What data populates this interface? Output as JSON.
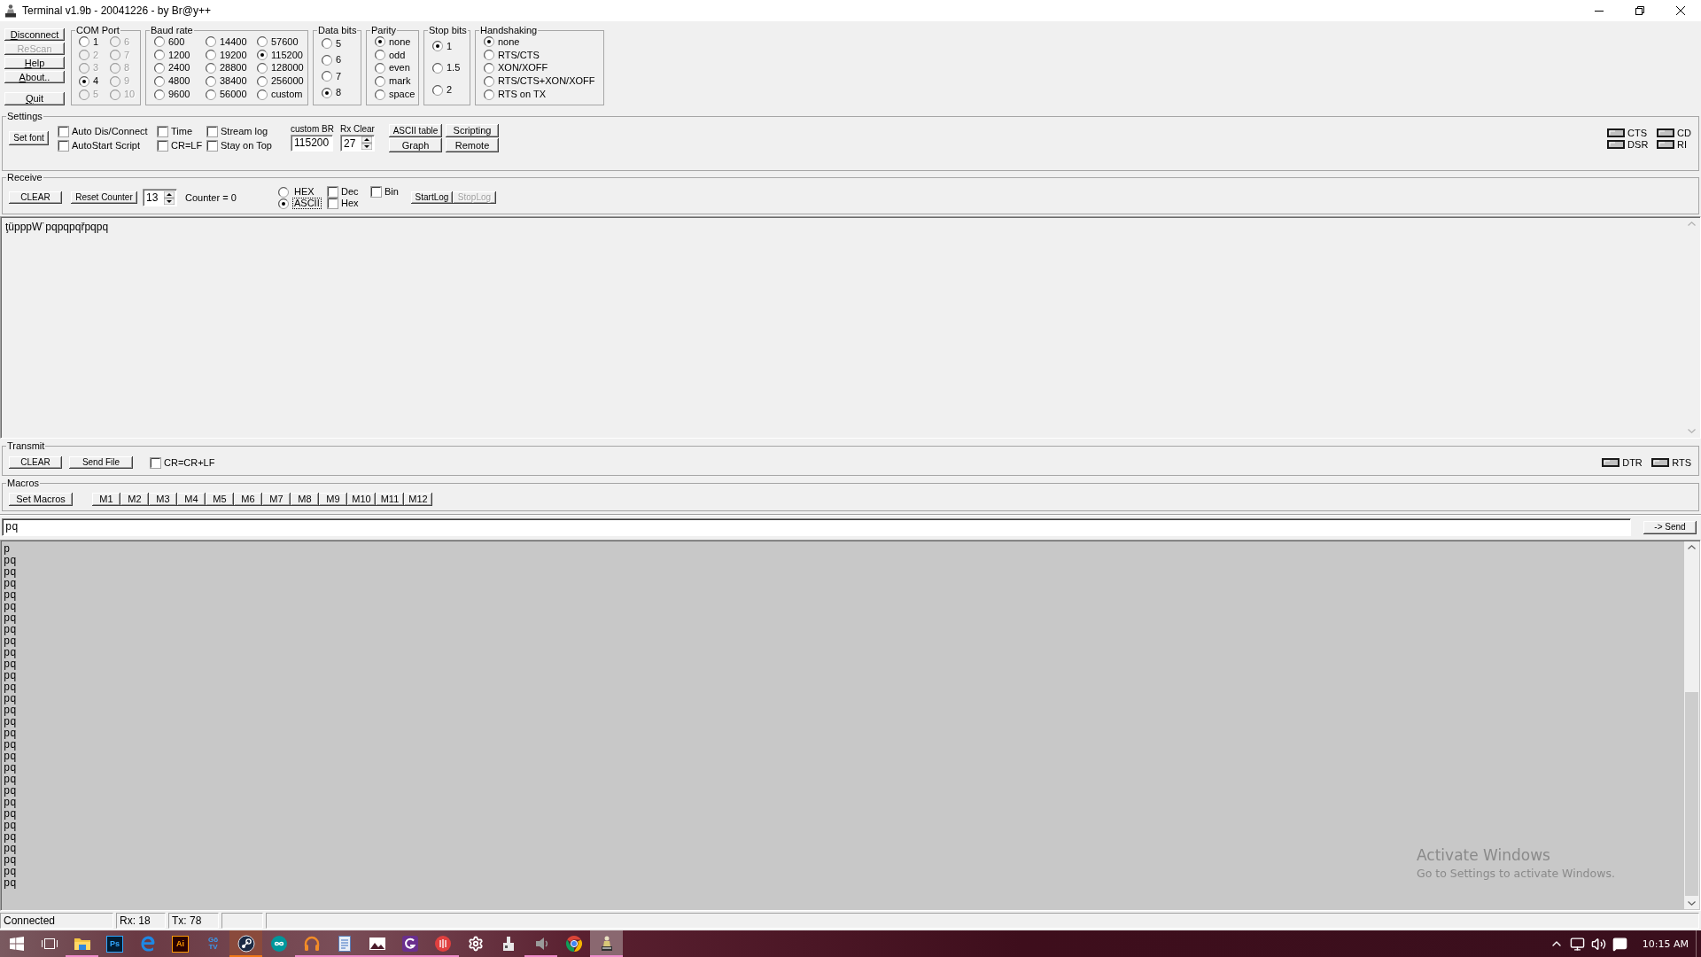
{
  "window": {
    "title": "Terminal v1.9b - 20041226 - by Br@y++"
  },
  "connection_buttons": [
    {
      "label": "Disconnect",
      "mnemonic": true,
      "disabled": false
    },
    {
      "label": "ReScan",
      "mnemonic": false,
      "disabled": true
    },
    {
      "label": "Help",
      "mnemonic": true,
      "disabled": false
    },
    {
      "label": "About..",
      "mnemonic": true,
      "disabled": false
    },
    {
      "label": "Quit",
      "mnemonic": true,
      "disabled": false
    }
  ],
  "com_port": {
    "title": "COM Port",
    "options": [
      {
        "label": "1",
        "selected": false,
        "disabled": false
      },
      {
        "label": "2",
        "selected": false,
        "disabled": true
      },
      {
        "label": "3",
        "selected": false,
        "disabled": true
      },
      {
        "label": "4",
        "selected": true,
        "disabled": false
      },
      {
        "label": "5",
        "selected": false,
        "disabled": true
      },
      {
        "label": "6",
        "selected": false,
        "disabled": true
      },
      {
        "label": "7",
        "selected": false,
        "disabled": true
      },
      {
        "label": "8",
        "selected": false,
        "disabled": true
      },
      {
        "label": "9",
        "selected": false,
        "disabled": true
      },
      {
        "label": "10",
        "selected": false,
        "disabled": true
      }
    ]
  },
  "baud_rate": {
    "title": "Baud rate",
    "options": [
      {
        "label": "600",
        "selected": false
      },
      {
        "label": "1200",
        "selected": false
      },
      {
        "label": "2400",
        "selected": false
      },
      {
        "label": "4800",
        "selected": false
      },
      {
        "label": "9600",
        "selected": false
      },
      {
        "label": "14400",
        "selected": false
      },
      {
        "label": "19200",
        "selected": false
      },
      {
        "label": "28800",
        "selected": false
      },
      {
        "label": "38400",
        "selected": false
      },
      {
        "label": "56000",
        "selected": false
      },
      {
        "label": "57600",
        "selected": false
      },
      {
        "label": "115200",
        "selected": true
      },
      {
        "label": "128000",
        "selected": false
      },
      {
        "label": "256000",
        "selected": false
      },
      {
        "label": "custom",
        "selected": false
      }
    ]
  },
  "data_bits": {
    "title": "Data bits",
    "options": [
      {
        "label": "5",
        "selected": false
      },
      {
        "label": "6",
        "selected": false
      },
      {
        "label": "7",
        "selected": false
      },
      {
        "label": "8",
        "selected": true
      }
    ]
  },
  "parity": {
    "title": "Parity",
    "options": [
      {
        "label": "none",
        "selected": true
      },
      {
        "label": "odd",
        "selected": false
      },
      {
        "label": "even",
        "selected": false
      },
      {
        "label": "mark",
        "selected": false
      },
      {
        "label": "space",
        "selected": false
      }
    ]
  },
  "stop_bits": {
    "title": "Stop bits",
    "options": [
      {
        "label": "1",
        "selected": true
      },
      {
        "label": "1.5",
        "selected": false
      },
      {
        "label": "2",
        "selected": false
      }
    ]
  },
  "handshaking": {
    "title": "Handshaking",
    "options": [
      {
        "label": "none",
        "selected": true
      },
      {
        "label": "RTS/CTS",
        "selected": false
      },
      {
        "label": "XON/XOFF",
        "selected": false
      },
      {
        "label": "RTS/CTS+XON/XOFF",
        "selected": false
      },
      {
        "label": "RTS on TX",
        "selected": false
      }
    ]
  },
  "settings": {
    "title": "Settings",
    "font_button": "Set font",
    "options": [
      {
        "label": "Auto Dis/Connect",
        "checked": false
      },
      {
        "label": "AutoStart Script",
        "checked": false
      },
      {
        "label": "Time",
        "checked": false
      },
      {
        "label": "CR=LF",
        "checked": false
      },
      {
        "label": "Stream log",
        "checked": false
      },
      {
        "label": "Stay on Top",
        "checked": false
      }
    ],
    "custom_baud": {
      "label": "custom BR",
      "value": "115200"
    },
    "rx_clear": {
      "label": "Rx Clear",
      "value": "27"
    },
    "tools": [
      "ASCII table",
      "Scripting",
      "Graph",
      "Remote"
    ],
    "indicators": [
      {
        "label": "CTS",
        "on": false
      },
      {
        "label": "CD",
        "on": false
      },
      {
        "label": "DSR",
        "on": false
      },
      {
        "label": "RI",
        "on": false
      }
    ]
  },
  "receive": {
    "title": "Receive",
    "clear_button": "CLEAR",
    "reset_button": "Reset Counter",
    "counter_value": "13",
    "counter": "Counter = 0",
    "formats": [
      {
        "label": "HEX",
        "selected": false,
        "focused": false
      },
      {
        "label": "ASCII",
        "selected": true,
        "focused": true
      }
    ],
    "options": [
      {
        "label": "Dec",
        "checked": false
      },
      {
        "label": "Hex",
        "checked": false
      },
      {
        "label": "Bin",
        "checked": false
      }
    ],
    "log_buttons": [
      {
        "label": "StartLog",
        "disabled": false
      },
      {
        "label": "StopLog",
        "disabled": true
      }
    ],
    "text": "ţüpppW˙pqpqpqřpqpq"
  },
  "transmit": {
    "title": "Transmit",
    "clear_button": "CLEAR",
    "send_file_button": "Send File",
    "option": {
      "label": "CR=CR+LF",
      "checked": false
    },
    "indicators": [
      {
        "label": "DTR",
        "on": false
      },
      {
        "label": "RTS",
        "on": false
      }
    ]
  },
  "macros": {
    "title": "Macros",
    "set_button": "Set Macros",
    "buttons": [
      "M1",
      "M2",
      "M3",
      "M4",
      "M5",
      "M6",
      "M7",
      "M8",
      "M9",
      "M10",
      "M11",
      "M12"
    ]
  },
  "send_line": {
    "value": "pq",
    "button": "-> Send"
  },
  "transmit_log": {
    "lines": [
      "p",
      "pq",
      "pq",
      "pq",
      "pq",
      "pq",
      "pq",
      "pq",
      "pq",
      "pq",
      "pq",
      "pq",
      "pq",
      "pq",
      "pq",
      "pq",
      "pq",
      "pq",
      "pq",
      "pq",
      "pq",
      "pq",
      "pq",
      "pq",
      "pq",
      "pq",
      "pq",
      "pq",
      "pq",
      "pq"
    ]
  },
  "activation_notice": {
    "title": "Activate Windows",
    "message": "Go to Settings to activate Windows."
  },
  "status_bar": {
    "panels": [
      "Connected",
      "Rx: 18",
      "Tx: 78"
    ]
  },
  "taskbar": {
    "apps": [
      {
        "kind": "start",
        "running": false,
        "flashing": false,
        "selected": false
      },
      {
        "kind": "task-view",
        "running": false,
        "flashing": false,
        "selected": false
      },
      {
        "kind": "folder",
        "running": true,
        "flashing": false,
        "selected": false
      },
      {
        "kind": "ps",
        "glyph": "Ps",
        "running": false,
        "flashing": false,
        "selected": false
      },
      {
        "kind": "edge",
        "running": false,
        "flashing": false,
        "selected": false
      },
      {
        "kind": "ai",
        "glyph": "Ai",
        "running": false,
        "flashing": false,
        "selected": false
      },
      {
        "kind": "gotv",
        "glyph": "Gõ TV",
        "running": false,
        "flashing": false,
        "selected": false
      },
      {
        "kind": "steam",
        "running": true,
        "flashing": true,
        "selected": false
      },
      {
        "kind": "arduino",
        "running": false,
        "flashing": false,
        "selected": false
      },
      {
        "kind": "headphones",
        "running": true,
        "flashing": false,
        "selected": false
      },
      {
        "kind": "document",
        "running": true,
        "flashing": false,
        "selected": false
      },
      {
        "kind": "photos",
        "running": true,
        "flashing": false,
        "selected": false
      },
      {
        "kind": "swirl",
        "running": true,
        "flashing": false,
        "selected": false
      },
      {
        "kind": "red-disc",
        "running": true,
        "flashing": false,
        "selected": false
      },
      {
        "kind": "gear",
        "running": false,
        "flashing": false,
        "selected": false
      },
      {
        "kind": "device",
        "running": false,
        "flashing": false,
        "selected": false
      },
      {
        "kind": "speaker",
        "running": true,
        "flashing": false,
        "selected": false
      },
      {
        "kind": "chrome",
        "running": false,
        "flashing": false,
        "selected": false
      },
      {
        "kind": "terminal",
        "running": true,
        "flashing": false,
        "selected": true
      }
    ],
    "tray": [
      {
        "kind": "chevron"
      },
      {
        "kind": "network"
      },
      {
        "kind": "volume"
      },
      {
        "kind": "notifications"
      }
    ],
    "clock": "10:15 AM"
  }
}
